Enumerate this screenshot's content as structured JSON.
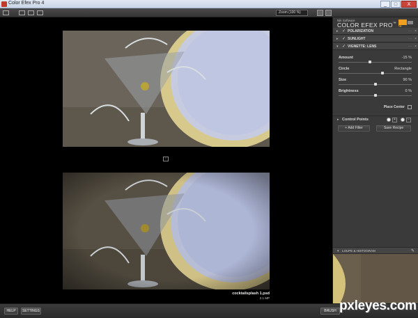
{
  "window": {
    "title": "Color Efex Pro 4",
    "controls": [
      "_",
      "□",
      "X"
    ]
  },
  "toolbar": {
    "zoom_label": "Zoom (100 %)"
  },
  "preview": {
    "compare_icon": "↕",
    "file_name": "cocktailsplash 1.psd",
    "file_size": "2.1 MP"
  },
  "panel": {
    "brand_small": "Nik Software",
    "brand_name": "COLOR EFEX PRO",
    "brand_tm": "™",
    "brand_version": "4",
    "filters": [
      {
        "name": "POLARIZATION",
        "controls": "⋯",
        "close": "×"
      },
      {
        "name": "SUNLIGHT",
        "controls": "⋯",
        "close": "×"
      },
      {
        "name": "VIGNETTE: LENS",
        "controls": "⋯",
        "close": "×"
      }
    ],
    "params": {
      "amount": {
        "label": "Amount",
        "value": "-15 %",
        "position": 0.43
      },
      "shape": {
        "label_left": "Circle",
        "label_right": "Rectangle",
        "position": 0.6
      },
      "size": {
        "label": "Size",
        "value": "90 %",
        "position": 0.5
      },
      "brightness": {
        "label": "Brightness",
        "value": "0 %",
        "position": 0.5
      }
    },
    "place_center": "Place Center",
    "control_points": "Control Points",
    "add_filter": "+ Add Filter",
    "save_recipe": "Save Recipe",
    "loupe_label": "LOUPE & HISTOGRAM"
  },
  "bottom": {
    "help": "HELP",
    "settings": "SETTINGS",
    "brush": "BRUSH"
  },
  "watermark": "pxleyes.com"
}
